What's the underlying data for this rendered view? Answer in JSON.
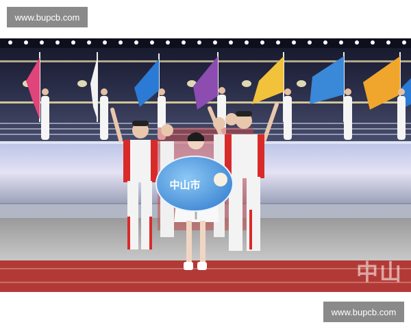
{
  "watermark_top": "www.bupcb.com",
  "watermark_bottom": "www.bupcb.com",
  "sign_text": "中山市",
  "corner_logo_text": "中山",
  "colors": {
    "uniform_red": "#d92a2a",
    "uniform_white": "#f3f3f3",
    "sign_blue": "#4a9be0",
    "track_red": "#b23a36",
    "stage_bg": "#1a1d33",
    "watermark_bg": "#8a8a8a"
  }
}
